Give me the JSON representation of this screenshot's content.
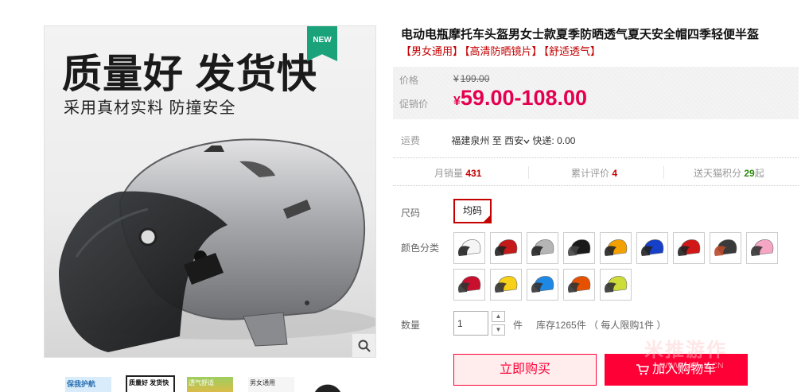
{
  "gallery": {
    "badge": "NEW",
    "promo_title": "质量好 发货快",
    "promo_subtitle": "采用真材实料 防撞安全",
    "zoom_icon": "magnifier-icon",
    "thumbnails": [
      {
        "caption": "保我护航"
      },
      {
        "caption": "质量好 发货快"
      },
      {
        "caption": "透气舒适"
      },
      {
        "caption": "男女通用"
      },
      {
        "caption": ""
      }
    ]
  },
  "product": {
    "title": "电动电瓶摩托车头盔男女士款夏季防晒透气夏天安全帽四季轻便半盔",
    "tags": [
      "【男女通用】",
      "【高清防晒镜片】",
      "【舒适透气】"
    ]
  },
  "price": {
    "original_label": "价格",
    "original_currency": "¥",
    "original_value": "199.00",
    "promo_label": "促销价",
    "promo_currency": "¥",
    "promo_value": "59.00-108.00"
  },
  "shipping": {
    "label": "运费",
    "from": "福建泉州",
    "to_word": "至",
    "to": "西安",
    "method": "快递: 0.00"
  },
  "stats": {
    "monthly_label": "月销量",
    "monthly_value": "431",
    "reviews_label": "累计评价",
    "reviews_value": "4",
    "points_label": "送天猫积分",
    "points_value": "29",
    "points_suffix": "起"
  },
  "size": {
    "label": "尺码",
    "selected": "均码"
  },
  "color": {
    "label": "颜色分类",
    "swatches": [
      {
        "shell": "#f5f5f5",
        "visor": "#222"
      },
      {
        "shell": "#c41a1a",
        "visor": "#222"
      },
      {
        "shell": "#b5b5b5",
        "visor": "#222"
      },
      {
        "shell": "#1a1a1a",
        "visor": "#444"
      },
      {
        "shell": "#f2a100",
        "visor": "#222"
      },
      {
        "shell": "#1740c8",
        "visor": "#222"
      },
      {
        "shell": "#d01818",
        "visor": "#222"
      },
      {
        "shell": "#3a3a3a",
        "visor": "#b84a2a"
      },
      {
        "shell": "#f4a6c4",
        "visor": "#333"
      },
      {
        "shell": "#c8102e",
        "visor": "#333"
      },
      {
        "shell": "#f7d117",
        "visor": "#333"
      },
      {
        "shell": "#1e88e5",
        "visor": "#333"
      },
      {
        "shell": "#e65100",
        "visor": "#333"
      },
      {
        "shell": "#cddc39",
        "visor": "#333"
      }
    ]
  },
  "quantity": {
    "label": "数量",
    "value": "1",
    "unit": "件",
    "stock": "库存1265件 （ 每人限购1件 ）"
  },
  "actions": {
    "buy_now": "立即购买",
    "add_to_cart": "加入购物车",
    "cart_icon": "cart-icon"
  },
  "watermark": {
    "text": "米推游作",
    "sub": "WWW.MIT...N.CN"
  },
  "colors": {
    "accent": "#ff0036",
    "price": "#e5004f",
    "tag": "#c40000"
  }
}
